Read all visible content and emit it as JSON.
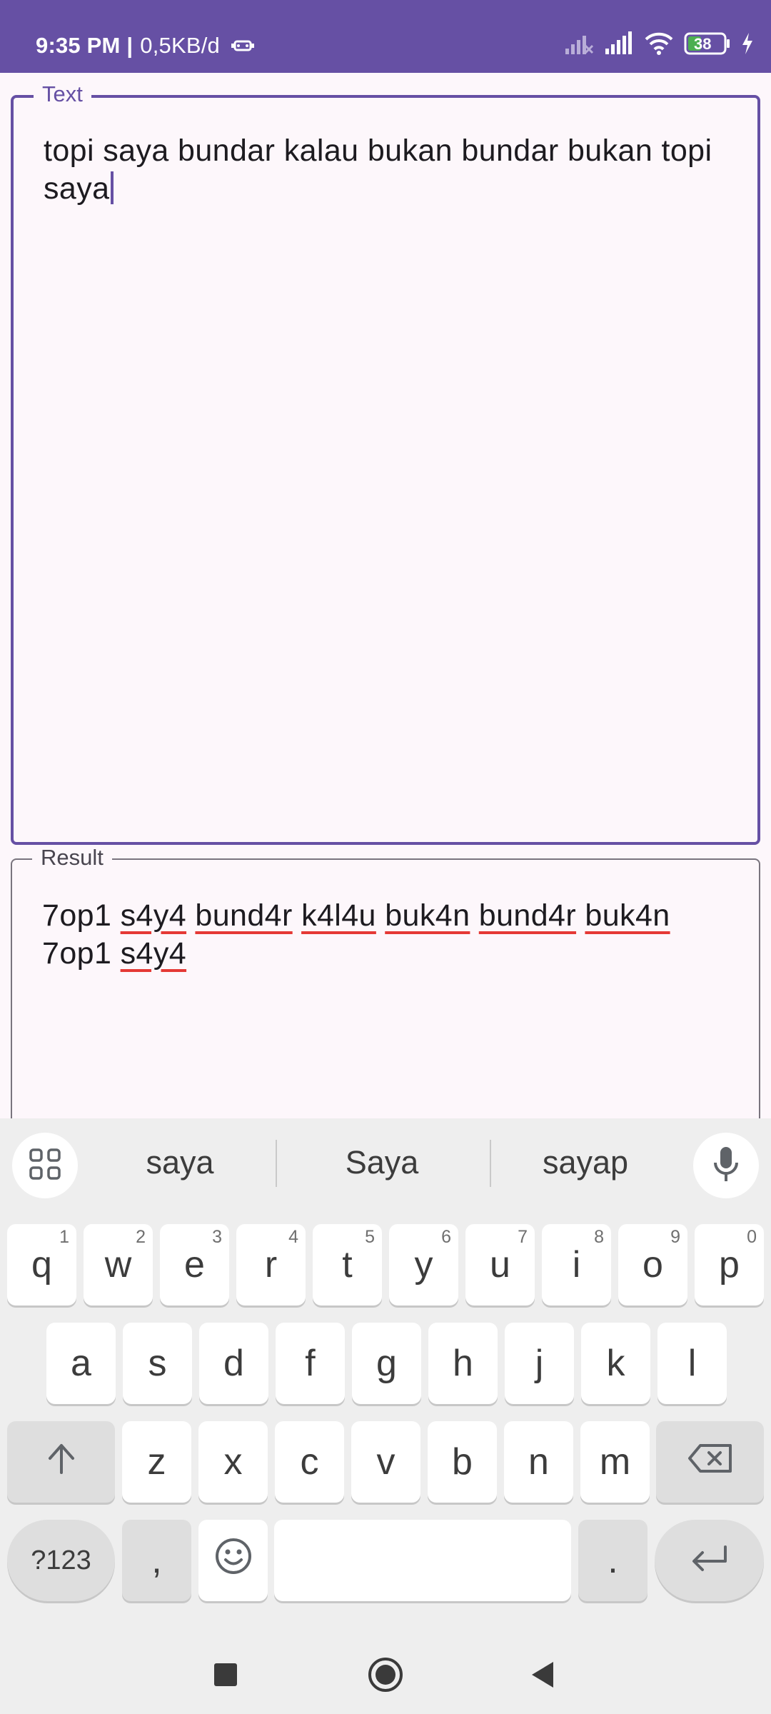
{
  "status_bar": {
    "time": "9:35 PM |",
    "network_speed": "0,5KB/d",
    "battery_level": "38",
    "icons": [
      "android-auto-icon",
      "signal-no-service-icon",
      "signal-icon",
      "wifi-icon",
      "battery-icon",
      "charging-icon"
    ]
  },
  "text_field": {
    "label": "Text",
    "value": "topi saya bundar kalau bukan bundar bukan topi saya"
  },
  "result_field": {
    "label": "Result",
    "words": [
      "7op1",
      "s4y4",
      "bund4r",
      "k4l4u",
      "buk4n",
      "bund4r",
      "buk4n",
      "7op1",
      "s4y4"
    ]
  },
  "keyboard": {
    "suggestions": [
      "saya",
      "Saya",
      "sayap"
    ],
    "row1": [
      {
        "label": "q",
        "hint": "1"
      },
      {
        "label": "w",
        "hint": "2"
      },
      {
        "label": "e",
        "hint": "3"
      },
      {
        "label": "r",
        "hint": "4"
      },
      {
        "label": "t",
        "hint": "5"
      },
      {
        "label": "y",
        "hint": "6"
      },
      {
        "label": "u",
        "hint": "7"
      },
      {
        "label": "i",
        "hint": "8"
      },
      {
        "label": "o",
        "hint": "9"
      },
      {
        "label": "p",
        "hint": "0"
      }
    ],
    "row2": [
      "a",
      "s",
      "d",
      "f",
      "g",
      "h",
      "j",
      "k",
      "l"
    ],
    "row3": [
      "z",
      "x",
      "c",
      "v",
      "b",
      "n",
      "m"
    ],
    "symbols_label": "?123",
    "comma_label": ",",
    "period_label": "."
  },
  "colors": {
    "primary": "#6650a4",
    "spell_underline": "#e53935",
    "background": "#fdf7fb",
    "keyboard_bg": "#eeeeee"
  }
}
